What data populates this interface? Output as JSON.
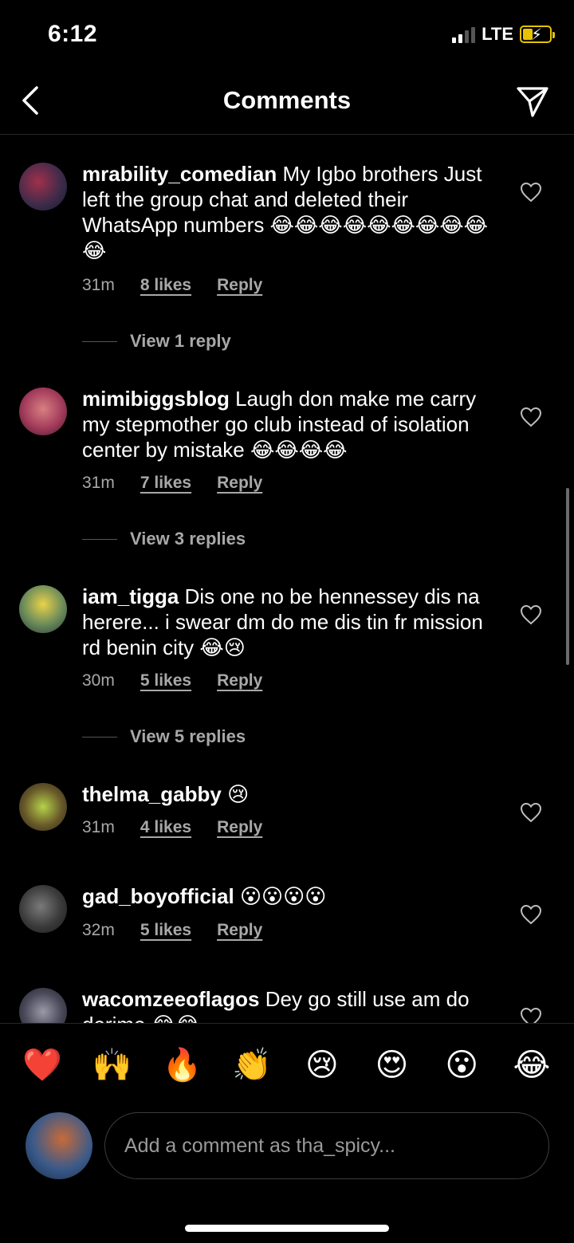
{
  "status": {
    "time": "6:12",
    "network": "LTE"
  },
  "header": {
    "title": "Comments"
  },
  "comments": [
    {
      "username": "mrability_comedian",
      "text": "My Igbo brothers Just left the group chat and deleted their WhatsApp numbers 😂😂😂😂😂😂😂😂😂😂",
      "time": "31m",
      "likes": "8 likes",
      "reply": "Reply",
      "view_replies": "View 1 reply"
    },
    {
      "username": "mimibiggsblog",
      "text": "Laugh don make me carry my stepmother go club instead of isolation center by mistake 😂😂😂😂",
      "time": "31m",
      "likes": "7 likes",
      "reply": "Reply",
      "view_replies": "View 3 replies"
    },
    {
      "username": "iam_tigga",
      "text": "Dis one no be hennessey dis na herere... i swear dm do me dis tin fr mission rd benin city 😂😢",
      "time": "30m",
      "likes": "5 likes",
      "reply": "Reply",
      "view_replies": "View 5 replies"
    },
    {
      "username": "thelma_gabby",
      "text": "😢",
      "time": "31m",
      "likes": "4 likes",
      "reply": "Reply"
    },
    {
      "username": "gad_boyofficial",
      "text": "😮😮😮😮",
      "time": "32m",
      "likes": "5 likes",
      "reply": "Reply"
    },
    {
      "username": "wacomzeeoflagos",
      "text": "Dey go still use am do derime 😂😂"
    }
  ],
  "emoji_bar": [
    "❤️",
    "🙌",
    "🔥",
    "👏",
    "😢",
    "😍",
    "😮",
    "😂"
  ],
  "composer": {
    "placeholder": "Add a comment as tha_spicy..."
  },
  "colors": {
    "background": "#000000",
    "text": "#ffffff",
    "muted": "#a8a8a8",
    "divider": "#262626"
  },
  "icons": {
    "back": "chevron-left-icon",
    "send": "paper-plane-icon",
    "like": "heart-outline-icon"
  }
}
